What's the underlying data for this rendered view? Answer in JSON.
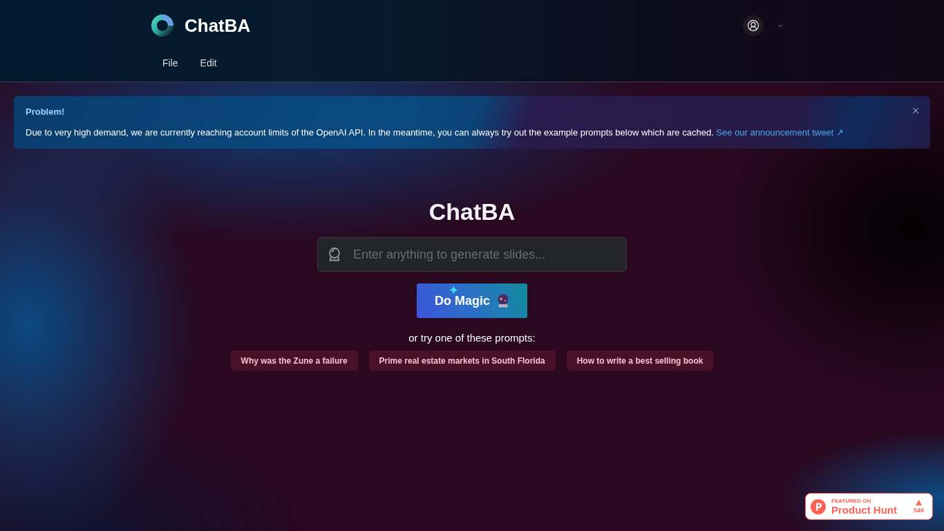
{
  "header": {
    "brand": "ChatBA",
    "menu": [
      {
        "label": "File"
      },
      {
        "label": "Edit"
      }
    ]
  },
  "alert": {
    "title": "Problem!",
    "message": "Due to very high demand, we are currently reaching account limits of the OpenAI API. In the meantime, you can always try out the example prompts below which are cached.",
    "link": "See our announcement tweet ↗"
  },
  "hero": {
    "title": "ChatBA",
    "search": {
      "placeholder": "Enter anything to generate slides..."
    },
    "button": {
      "label": "Do Magic"
    },
    "prompts_label": "or try one of these prompts:",
    "prompts": [
      "Why was the Zune a failure",
      "Prime real estate markets in South Florida",
      "How to write a best selling book"
    ]
  },
  "product_hunt": {
    "caption": "FEATURED ON",
    "name": "Product Hunt",
    "votes": "549"
  }
}
